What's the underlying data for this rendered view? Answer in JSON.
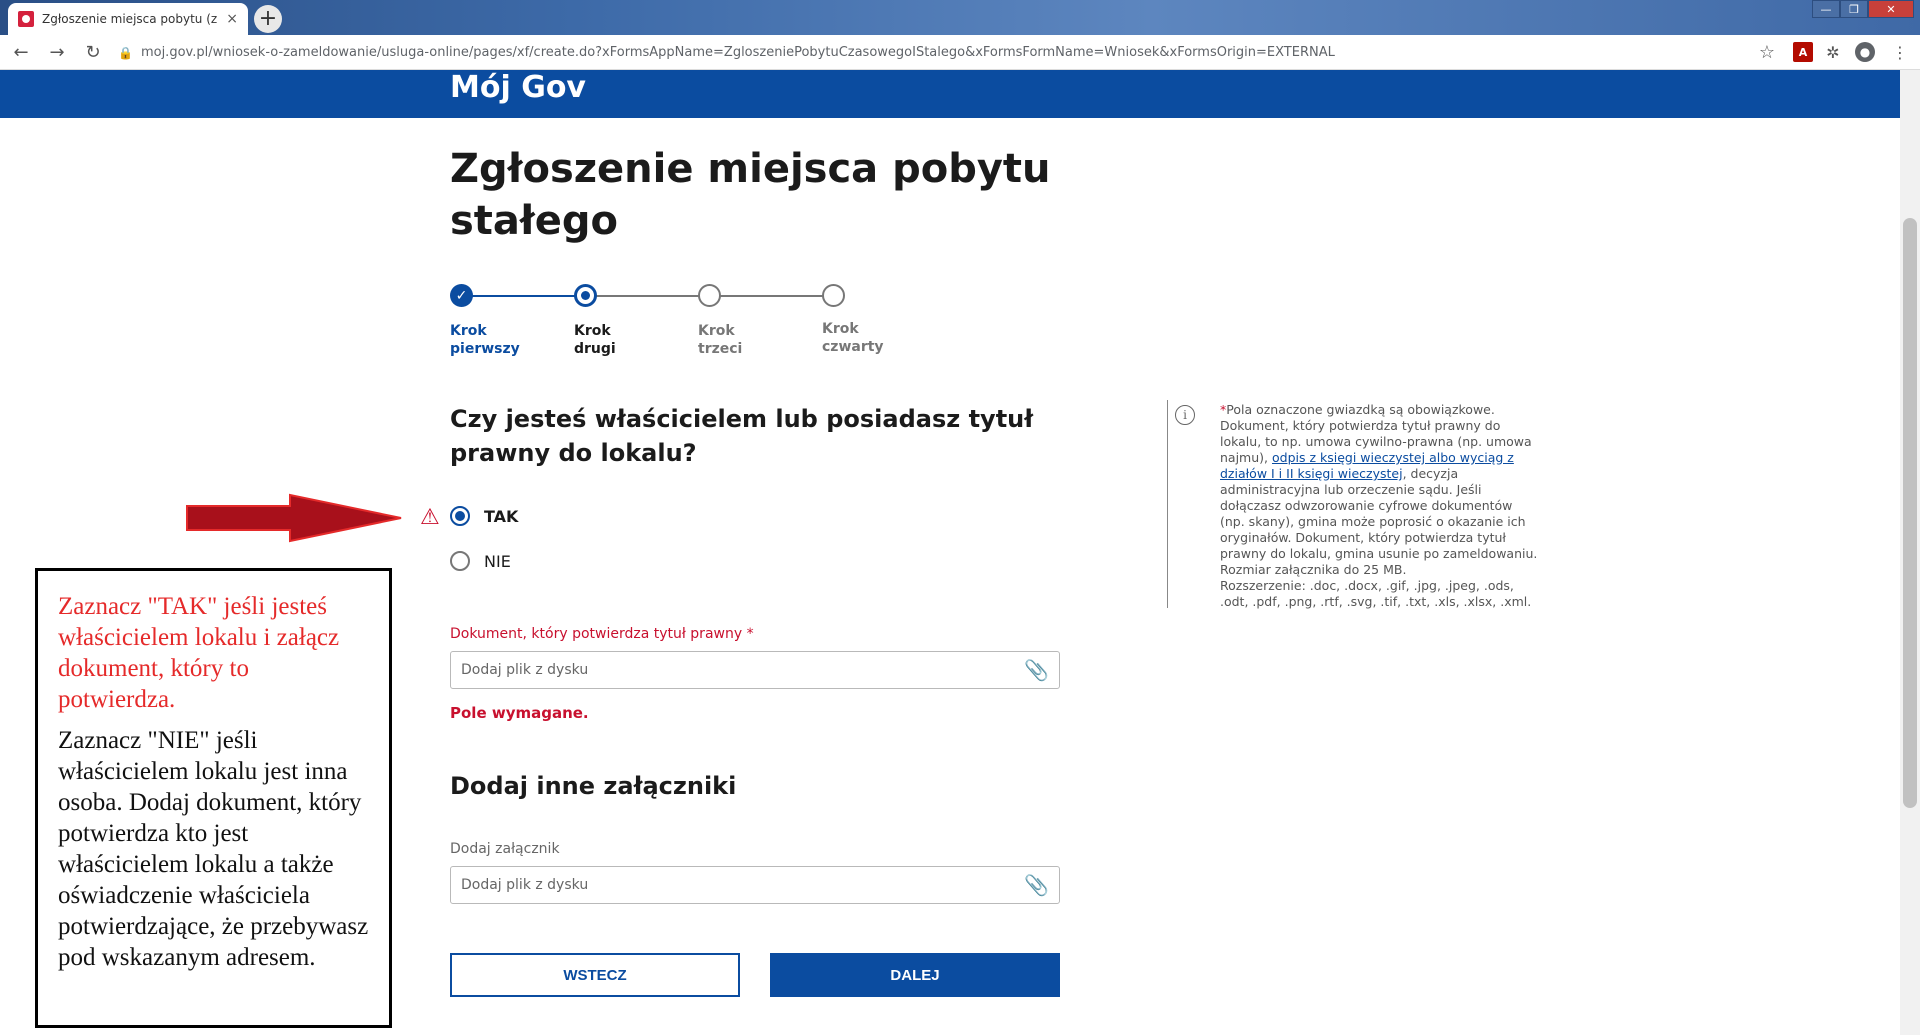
{
  "browser": {
    "tab_title": "Zgłoszenie miejsca pobytu (zame",
    "tab_close": "×",
    "new_tab": "+",
    "url": "moj.gov.pl/wniosek-o-zameldowanie/usluga-online/pages/xf/create.do?xFormsAppName=ZgloszeniePobytuCzasowegoIStalego&xFormsFormName=Wniosek&xFormsOrigin=EXTERNAL",
    "back": "←",
    "forward": "→",
    "reload": "↻",
    "star": "☆",
    "window_min": "—",
    "window_max": "❐",
    "window_close": "✕"
  },
  "header": {
    "brand": "Mój Gov"
  },
  "page": {
    "title": "Zgłoszenie miejsca pobytu stałego",
    "steps": [
      {
        "line1": "Krok",
        "line2": "pierwszy",
        "state": "done"
      },
      {
        "line1": "Krok",
        "line2": "drugi",
        "state": "active"
      },
      {
        "line1": "Krok",
        "line2": "trzeci",
        "state": "todo"
      },
      {
        "line1": "Krok",
        "line2": "czwarty",
        "state": "todo"
      }
    ],
    "question": "Czy jesteś właścicielem lub posiadasz tytuł prawny do lokalu?",
    "options": [
      {
        "label": "TAK",
        "checked": true
      },
      {
        "label": "NIE",
        "checked": false
      }
    ],
    "doc_label": "Dokument, który potwierdza tytuł prawny *",
    "doc_placeholder": "Dodaj plik z dysku",
    "error": "Pole wymagane.",
    "other_heading": "Dodaj inne załączniki",
    "attach_label": "Dodaj załącznik",
    "attach_placeholder": "Dodaj plik z dysku",
    "back_button": "WSTECZ",
    "next_button": "DALEJ"
  },
  "info": {
    "icon": "i",
    "req_mark": "*",
    "text_before_link": "Pola oznaczone gwiazdką są obowiązkowe. Dokument, który potwierdza tytuł prawny do lokalu, to np. umowa cywilno-prawna (np. umowa najmu),",
    "link": "odpis z księgi wieczystej albo wyciąg z działów I i II księgi wieczystej",
    "text_after_link": ", decyzja administracyjna lub orzeczenie sądu. Jeśli dołączasz odwzorowanie cyfrowe dokumentów (np. skany), gmina może poprosić o okazanie ich oryginałów. Dokument, który potwierdza tytuł prawny do lokalu, gmina usunie po zameldowaniu.",
    "size": "Rozmiar załącznika do 25 MB.",
    "extensions": "Rozszerzenie: .doc, .docx, .gif, .jpg, .jpeg, .ods, .odt, .pdf, .png, .rtf, .svg, .tif, .txt, .xls, .xlsx, .xml."
  },
  "annotation": {
    "red_text": "Zaznacz \"TAK\" jeśli jesteś właścicielem lokalu i załącz dokument, który to potwierdza.",
    "black_text": "Zaznacz \"NIE\" jeśli właścicielem lokalu jest inna osoba. Dodaj dokument, który potwierdza kto jest właścicielem lokalu a także oświadczenie właściciela potwierdzające, że przebywasz pod wskazanym adresem."
  },
  "colors": {
    "brand_blue": "#0b4ca0",
    "error_red": "#c8102e",
    "annotation_red": "#e52a2a",
    "arrow_red": "#a8101b"
  },
  "icons": {
    "lock": "lock-icon",
    "clip": "paperclip-icon",
    "warning": "warning-triangle-icon",
    "check": "checkmark-icon",
    "info": "info-icon"
  }
}
